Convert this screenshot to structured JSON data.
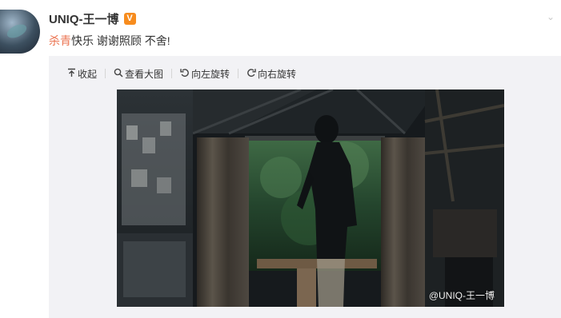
{
  "author": {
    "name": "UNIQ-王一博",
    "badge": "V"
  },
  "post": {
    "hashtag": "杀青",
    "text": "快乐 谢谢照顾 不舍!"
  },
  "toolbar": {
    "collapse_label": "收起",
    "view_large_label": "查看大图",
    "rotate_left_label": "向左旋转",
    "rotate_right_label": "向右旋转"
  },
  "image": {
    "watermark": "@UNIQ-王一博"
  },
  "icons": {
    "collapse": "collapse-arrow-icon",
    "view_large": "magnifier-icon",
    "rotate_left": "rotate-left-icon",
    "rotate_right": "rotate-right-icon",
    "verified": "verified-badge-icon",
    "menu": "chevron-down-icon"
  },
  "colors": {
    "hashtag": "#eb7350",
    "badge": "#f78c1e",
    "media_background": "#f2f2f5"
  }
}
